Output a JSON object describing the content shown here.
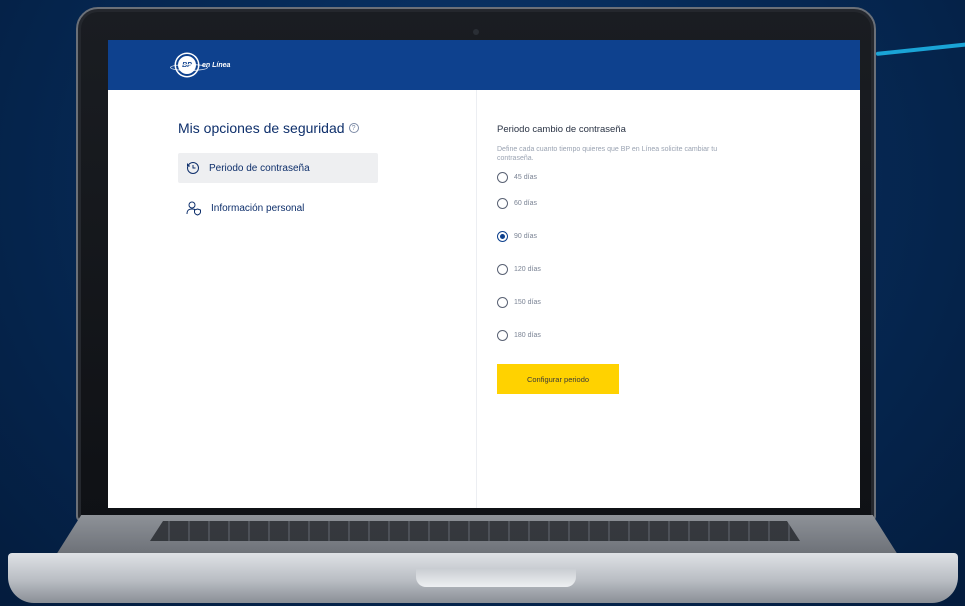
{
  "brand": {
    "logo_monogram": "BP",
    "logo_suffix": "en Línea",
    "topbar_color": "#0e418e",
    "accent_color": "#1aa4d6"
  },
  "sidebar": {
    "title": "Mis opciones de seguridad",
    "help_icon": "question-circle-icon",
    "items": [
      {
        "label": "Periodo de contraseña",
        "icon": "clock-history-icon",
        "active": true
      },
      {
        "label": "Información personal",
        "icon": "user-shield-icon",
        "active": false
      }
    ]
  },
  "main": {
    "title": "Periodo cambio de contraseña",
    "description": "Define cada cuanto tiempo quieres que BP en Línea solicite cambiar tu contraseña.",
    "options": [
      {
        "label": "45 días",
        "selected": false
      },
      {
        "label": "60 días",
        "selected": false
      },
      {
        "label": "90 días",
        "selected": true
      },
      {
        "label": "120 días",
        "selected": false
      },
      {
        "label": "150 días",
        "selected": false
      },
      {
        "label": "180 días",
        "selected": false
      }
    ],
    "submit_label": "Configurar periodo",
    "submit_color": "#ffd200"
  }
}
